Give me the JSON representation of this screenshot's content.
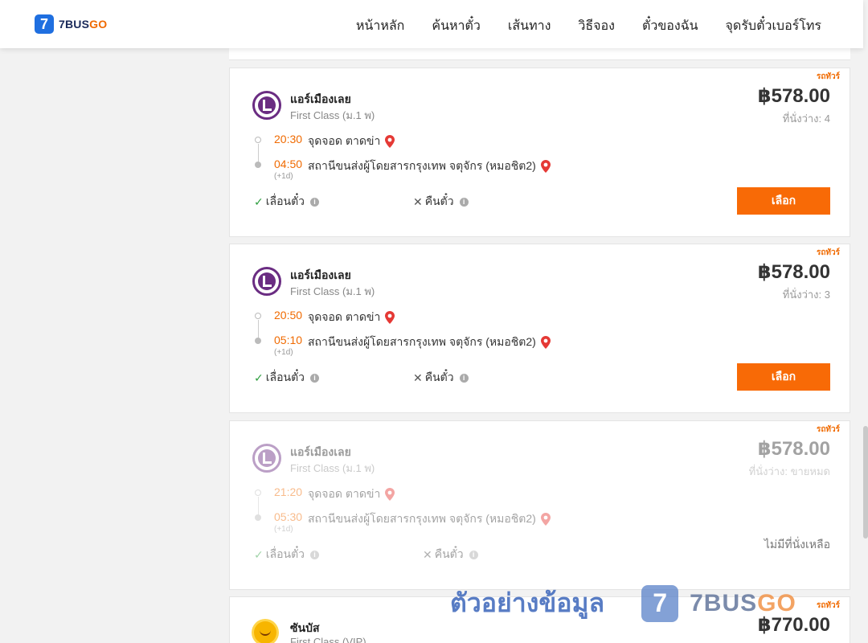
{
  "header": {
    "logo_mark": "7",
    "logo_brand": "7BUS",
    "logo_brand_go": "GO",
    "nav": [
      "หน้าหลัก",
      "ค้นหาตั๋ว",
      "เส้นทาง",
      "วิธีจอง",
      "ตั๋วของฉัน",
      "จุดรับตั๋วเบอร์โทร"
    ]
  },
  "trips": [
    {
      "tag": "รถทัวร์",
      "operator": "แอร์เมืองเลย",
      "class": "First Class (ม.1 พ)",
      "price": "฿578.00",
      "seats": "ที่นั่งว่าง: 4",
      "depart_time": "20:30",
      "depart_place": "จุดจอด ตาดข่า",
      "arrive_time": "04:50",
      "arrive_place": "สถานีขนส่งผู้โดยสารกรุงเทพ จตุจักร (หมอชิต2)",
      "next_day": "(+1d)",
      "feature_change": "เลื่อนตั๋ว",
      "feature_refund": "คืนตั๋ว",
      "button": "เลือก"
    },
    {
      "tag": "รถทัวร์",
      "operator": "แอร์เมืองเลย",
      "class": "First Class (ม.1 พ)",
      "price": "฿578.00",
      "seats": "ที่นั่งว่าง: 3",
      "depart_time": "20:50",
      "depart_place": "จุดจอด ตาดข่า",
      "arrive_time": "05:10",
      "arrive_place": "สถานีขนส่งผู้โดยสารกรุงเทพ จตุจักร (หมอชิต2)",
      "next_day": "(+1d)",
      "feature_change": "เลื่อนตั๋ว",
      "feature_refund": "คืนตั๋ว",
      "button": "เลือก"
    },
    {
      "tag": "รถทัวร์",
      "operator": "แอร์เมืองเลย",
      "class": "First Class (ม.1 พ)",
      "price": "฿578.00",
      "seats": "ที่นั่งว่าง: ขายหมด",
      "depart_time": "21:20",
      "depart_place": "จุดจอด ตาดข่า",
      "arrive_time": "05:30",
      "arrive_place": "สถานีขนส่งผู้โดยสารกรุงเทพ จตุจักร (หมอชิต2)",
      "next_day": "(+1d)",
      "feature_change": "เลื่อนตั๋ว",
      "feature_refund": "คืนตั๋ว",
      "no_seat": "ไม่มีที่นั่งเหลือ"
    },
    {
      "tag": "รถทัวร์",
      "operator": "ซันบัส",
      "class": "First Class (VIP)",
      "price": "฿770.00"
    }
  ],
  "watermark": {
    "text": "ตัวอย่างข้อมูล",
    "mark": "7",
    "brand": "7BUS",
    "brand_go": "GO"
  },
  "colors": {
    "accent": "#f86a06",
    "time": "#f06a00",
    "operator_purple": "#6a2c82"
  }
}
